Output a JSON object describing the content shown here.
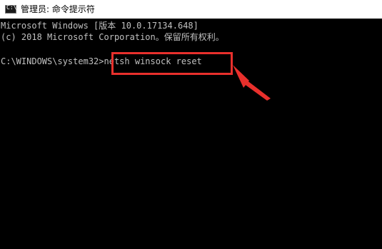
{
  "window": {
    "title": "管理员: 命令提示符",
    "icon": "cmd-icon",
    "icon_glyph": "C:\\",
    "colors": {
      "background": "#000000",
      "text": "#c0c0c0",
      "titlebar": "#ffffff",
      "annotation": "#e8302c"
    }
  },
  "console": {
    "version_line": "Microsoft Windows [版本 10.0.17134.648]",
    "copyright_line": "(c) 2018 Microsoft Corporation。保留所有权利。",
    "prompt": "C:\\WINDOWS\\system32>",
    "command": "netsh winsock reset"
  },
  "annotation": {
    "shape": "red-box-with-arrow",
    "target": "command"
  }
}
